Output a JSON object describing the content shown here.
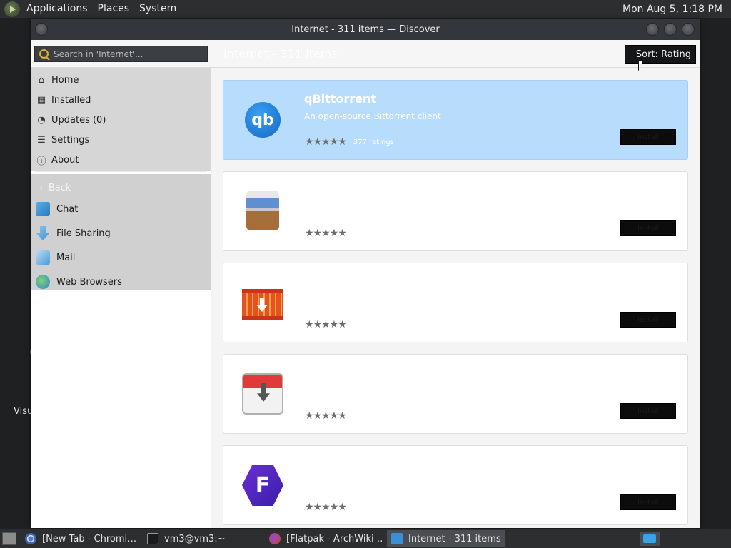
{
  "top_panel": {
    "menus": [
      "Applications",
      "Places",
      "System"
    ],
    "clock": "Mon Aug  5, 1:18 PM"
  },
  "desktop": {
    "label": "Visu",
    "dot": "("
  },
  "window": {
    "title": "Internet - 311 items — Discover",
    "search_placeholder": "Search in 'Internet'...",
    "heading": "Internet - 311 items",
    "sort_label": "Sort: Rating"
  },
  "sidebar": {
    "nav": [
      {
        "label": "Home",
        "icon": "home-icon"
      },
      {
        "label": "Installed",
        "icon": "installed-icon"
      },
      {
        "label": "Updates (0)",
        "icon": "updates-icon"
      },
      {
        "label": "Settings",
        "icon": "settings-icon"
      },
      {
        "label": "About",
        "icon": "info-icon"
      }
    ],
    "back": "Back",
    "categories": [
      {
        "label": "Chat",
        "icon": "chat-icon"
      },
      {
        "label": "File Sharing",
        "icon": "file-sharing-icon"
      },
      {
        "label": "Mail",
        "icon": "mail-icon"
      },
      {
        "label": "Web Browsers",
        "icon": "web-browsers-icon"
      }
    ]
  },
  "apps": [
    {
      "name": "qBittorrent",
      "description": "An open-source Bittorrent client",
      "rating": "★★★★★",
      "reviews": "377 ratings",
      "install": "Install"
    },
    {
      "name": "",
      "description": "",
      "rating": "★★★★★",
      "reviews": "",
      "install": "Install"
    },
    {
      "name": "",
      "description": "",
      "rating": "★★★★★",
      "reviews": "",
      "install": "Install"
    },
    {
      "name": "",
      "description": "",
      "rating": "★★★★★",
      "reviews": "",
      "install": "Install"
    },
    {
      "name": "",
      "description": "",
      "rating": "★★★★★",
      "reviews": "",
      "install": "Install"
    }
  ],
  "taskbar": {
    "tasks": [
      {
        "label": "[New Tab - Chromi…",
        "icon": "chromium-icon"
      },
      {
        "label": "vm3@vm3:~",
        "icon": "terminal-icon"
      },
      {
        "label": "[Flatpak - ArchWiki …",
        "icon": "firefox-icon"
      },
      {
        "label": "Internet - 311 items …",
        "icon": "discover-icon"
      }
    ]
  }
}
